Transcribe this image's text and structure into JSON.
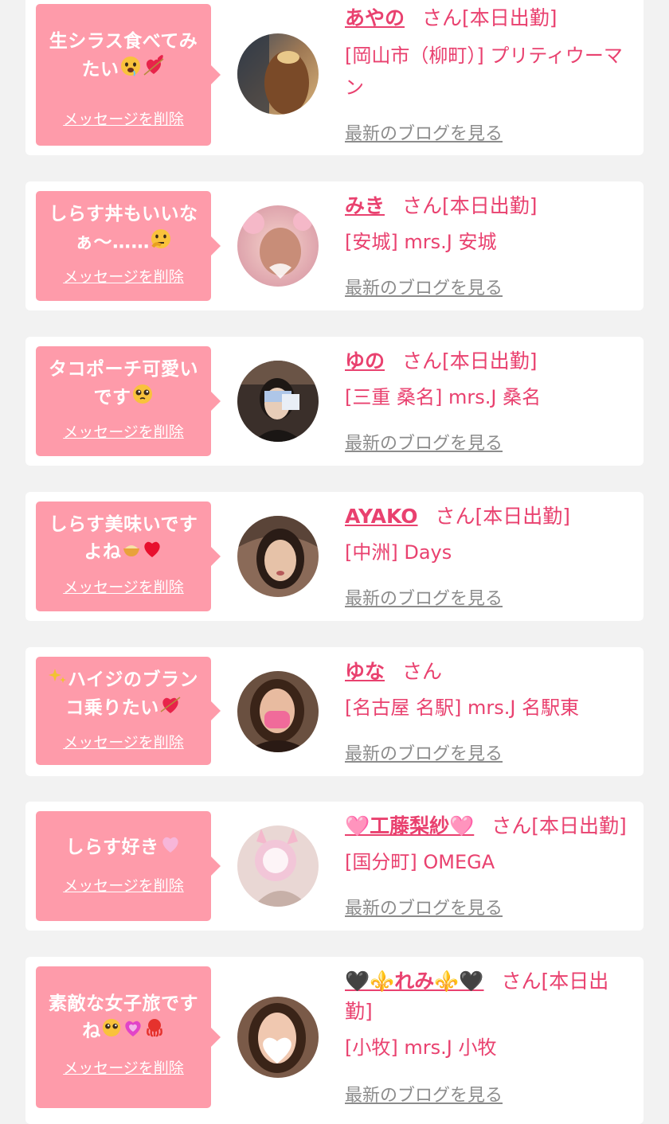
{
  "theme": {
    "bubble_color": "#fe9baa",
    "accent_color": "#e9416f",
    "link_gray": "#8c8c8c",
    "page_background": "#f2f2f2"
  },
  "labels": {
    "delete_message": "メッセージを削除",
    "view_blog": "最新のブログを見る"
  },
  "messages": [
    {
      "text": "生シラス食べてみたい",
      "emojis": [
        "drooling-face-icon",
        "heart-with-arrow-icon"
      ],
      "name": "あやの",
      "suffix": "さん[本日出勤]",
      "shop": "[岡山市（柳町）] プリティウーマン"
    },
    {
      "text": "しらす丼もいいなぁ〜……",
      "emojis": [
        "thinking-face-icon"
      ],
      "name": "みき",
      "suffix": "さん[本日出勤]",
      "shop": "[安城] mrs.J 安城"
    },
    {
      "text": "タコポーチ可愛いです",
      "emojis": [
        "pleading-face-icon"
      ],
      "name": "ゆの",
      "suffix": "さん[本日出勤]",
      "shop": "[三重 桑名] mrs.J 桑名"
    },
    {
      "text": "しらす美味いですよね",
      "emojis": [
        "food-bowl-icon",
        "red-heart-icon"
      ],
      "name": "AYAKO",
      "suffix": "さん[本日出勤]",
      "shop": "[中洲] Days"
    },
    {
      "text": "ハイジのブランコ乗りたい",
      "emojis": [
        "sparkles-icon",
        "heart-with-arrow-icon"
      ],
      "name": "ゆな",
      "suffix": "さん",
      "shop": "[名古屋 名駅] mrs.J 名駅東"
    },
    {
      "text": "しらす好き",
      "emojis": [
        "pink-heart-icon"
      ],
      "name": "🩷工藤梨紗🩷",
      "suffix": "さん[本日出勤]",
      "shop": "[国分町] OMEGA"
    },
    {
      "text": "素敵な女子旅ですね",
      "emojis": [
        "pleading-face-icon",
        "sparkling-heart-icon",
        "octopus-icon"
      ],
      "name": "🖤⚜️れみ⚜️🖤",
      "suffix": "さん[本日出勤]",
      "shop": "[小牧] mrs.J 小牧"
    }
  ]
}
